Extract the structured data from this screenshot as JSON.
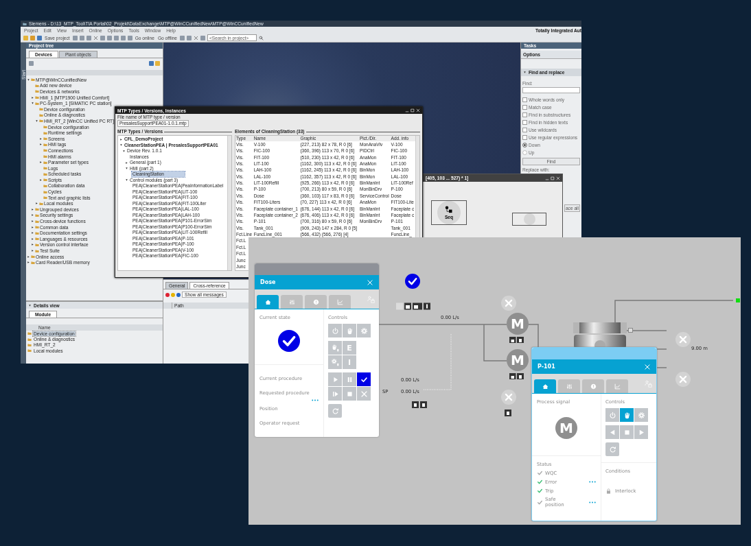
{
  "tia": {
    "title": "Siemens  -  D:\\13_MTP_Tool\\TIA Portal\\02_Projekt\\DataExchange\\MTP@WinCCunifiedNew\\MTP@WinCCunifiedNew",
    "brand": "Totally Integrated Aut",
    "menu": [
      "Project",
      "Edit",
      "View",
      "Insert",
      "Online",
      "Options",
      "Tools",
      "Window",
      "Help"
    ],
    "toolbar": {
      "save": "Save project",
      "go_online": "Go online",
      "go_offline": "Go offline",
      "search_placeholder": "<Search in project>"
    },
    "start_tab": "Start",
    "project_tree": {
      "title": "Project tree",
      "tabs": [
        {
          "label": "Devices",
          "selected": true
        },
        {
          "label": "Plant objects",
          "selected": false
        }
      ],
      "items": [
        {
          "label": "MTP@WinCCunifiedNew",
          "expanded": true,
          "children": [
            {
              "label": "Add new device"
            },
            {
              "label": "Devices & networks"
            },
            {
              "label": "HMI_1 [MTP1900 Unified Comfort]",
              "expanded": false
            },
            {
              "label": "PC-System_1 [SIMATIC PC station]",
              "expanded": true,
              "children": [
                {
                  "label": "Device configuration"
                },
                {
                  "label": "Online & diagnostics"
                },
                {
                  "label": "HMI_RT_2 [WinCC Unified PC RT]",
                  "expanded": true,
                  "children": [
                    {
                      "label": "Device configuration"
                    },
                    {
                      "label": "Runtime settings"
                    },
                    {
                      "label": "Screens",
                      "expanded": false
                    },
                    {
                      "label": "HMI tags",
                      "expanded": false
                    },
                    {
                      "label": "Connections"
                    },
                    {
                      "label": "HMI alarms"
                    },
                    {
                      "label": "Parameter set types",
                      "expanded": false
                    },
                    {
                      "label": "Logs"
                    },
                    {
                      "label": "Scheduled tasks"
                    },
                    {
                      "label": "Scripts",
                      "expanded": false
                    },
                    {
                      "label": "Collaboration data"
                    },
                    {
                      "label": "Cycles"
                    },
                    {
                      "label": "Text and graphic lists"
                    }
                  ]
                },
                {
                  "label": "Local modules",
                  "expanded": false
                }
              ]
            },
            {
              "label": "Ungrouped devices",
              "expanded": false
            },
            {
              "label": "Security settings",
              "expanded": false
            },
            {
              "label": "Cross-device functions",
              "expanded": false
            },
            {
              "label": "Common data",
              "expanded": false
            },
            {
              "label": "Documentation settings",
              "expanded": false
            },
            {
              "label": "Languages & resources",
              "expanded": false
            },
            {
              "label": "Version control interface",
              "expanded": false
            },
            {
              "label": "Test Suite",
              "expanded": false
            }
          ]
        },
        {
          "label": "Online access",
          "expanded": false
        },
        {
          "label": "Card Reader/USB memory",
          "expanded": false
        }
      ]
    },
    "details_view": {
      "title": "Details view",
      "tab": "Module",
      "column": "Name",
      "rows": [
        {
          "label": "Device configuration",
          "selected": true
        },
        {
          "label": "Online & diagnostics",
          "selected": false
        },
        {
          "label": "HMI_RT_2",
          "selected": false
        },
        {
          "label": "Local modules",
          "selected": false
        }
      ]
    },
    "inspector": {
      "tabs": [
        {
          "label": "General",
          "selected": false
        },
        {
          "label": "Cross-reference",
          "selected": true
        }
      ],
      "filter": "Show all messages",
      "column": "Path"
    },
    "tasks": {
      "title": "Tasks",
      "section": "Options",
      "panel": "Find and replace",
      "find_label": "Find:",
      "options": [
        {
          "label": "Whole words only",
          "checked": false
        },
        {
          "label": "Match case",
          "checked": false
        },
        {
          "label": "Find in substructures",
          "checked": false
        },
        {
          "label": "Find in hidden texts",
          "checked": false
        },
        {
          "label": "Use wildcards",
          "checked": false
        },
        {
          "label": "Use regular expressions",
          "checked": false
        }
      ],
      "directions": [
        {
          "label": "Down",
          "selected": true
        },
        {
          "label": "Up",
          "selected": false
        }
      ],
      "find_button": "Find",
      "replace_label": "Replace with:",
      "replace_all": "ace all"
    }
  },
  "seq_window": {
    "title": "[405, 103 ... 527) * 1]",
    "block_label": "Seq"
  },
  "mtp_dialog": {
    "title": "MTP Types / Versions, Instances",
    "file_label": "File name of MTP type / version",
    "file_value": "PresalesSupportPEA01-1.0.1.mtp",
    "types_heading": "MTP Types / Versions",
    "types": [
      {
        "label": "CFL_DemoProject",
        "expanded": false,
        "selected": false
      },
      {
        "label": "CleanerStationPEA | PresalesSupportPEA01",
        "expanded": true,
        "selected": false,
        "children": [
          {
            "label": "Device Rev. 1.0.1",
            "expanded": true,
            "selected": false,
            "children": [
              {
                "label": "Instances",
                "selected": false
              },
              {
                "label": "General (part 1)",
                "expanded": false,
                "selected": false
              },
              {
                "label": "HMI (part 2)",
                "expanded": true,
                "selected": false,
                "children": [
                  {
                    "label": "CleaningStation",
                    "selected": true
                  }
                ]
              },
              {
                "label": "Control modules (part 3)",
                "expanded": true,
                "selected": false,
                "children": [
                  {
                    "label": "PEA|CleanerStationPEA|PeaInformationLabel",
                    "selected": false
                  },
                  {
                    "label": "PEA|CleanerStationPEA|LIT-100",
                    "selected": false
                  },
                  {
                    "label": "PEA|CleanerStationPEA|FIT-100",
                    "selected": false
                  },
                  {
                    "label": "PEA|CleanerStationPEA|FIT-100Liter",
                    "selected": false
                  },
                  {
                    "label": "PEA|CleanerStationPEA|LAL-100",
                    "selected": false
                  },
                  {
                    "label": "PEA|CleanerStationPEA|LAH-100",
                    "selected": false
                  },
                  {
                    "label": "PEA|CleanerStationPEA|P101-ErrorSim",
                    "selected": false
                  },
                  {
                    "label": "PEA|CleanerStationPEA|P100-ErrorSim",
                    "selected": false
                  },
                  {
                    "label": "PEA|CleanerStationPEA|LIT-100Refill",
                    "selected": false
                  },
                  {
                    "label": "PEA|CleanerStationPEA|P-101",
                    "selected": false
                  },
                  {
                    "label": "PEA|CleanerStationPEA|P-100",
                    "selected": false
                  },
                  {
                    "label": "PEA|CleanerStationPEA|V-100",
                    "selected": false
                  },
                  {
                    "label": "PEA|CleanerStationPEA|FIC-100",
                    "selected": false
                  }
                ]
              }
            ]
          }
        ]
      }
    ],
    "elements_heading": "Elements of CleaningStation (33)",
    "columns": [
      "Type",
      "Name",
      "Graphic",
      "Pict./Dir.",
      "Add. info"
    ],
    "rows": [
      {
        "type": "Vis.",
        "name": "V-100",
        "graphic": "(227, 213) 82 x 78, R 0 [6]",
        "pict": "MonAnaVlv",
        "info": "V-100"
      },
      {
        "type": "Vis.",
        "name": "FIC-100",
        "graphic": "(360, 396) 113 x 70, R 0 [6]",
        "pict": "PIDCtrl",
        "info": "FIC-100"
      },
      {
        "type": "Vis.",
        "name": "FIT-100",
        "graphic": "(510, 230) 113 x 42, R 0 [6]",
        "pict": "AnaMon",
        "info": "FIT-100"
      },
      {
        "type": "Vis.",
        "name": "LIT-100",
        "graphic": "(1162, 300) 113 x 42, R 0 [6]",
        "pict": "AnaMon",
        "info": "LIT-100"
      },
      {
        "type": "Vis.",
        "name": "LAH-100",
        "graphic": "(1162, 245) 113 x 42, R 0 [6]",
        "pict": "BinMon",
        "info": "LAH-100"
      },
      {
        "type": "Vis.",
        "name": "LAL-100",
        "graphic": "(1162, 357) 113 x 42, R 0 [6]",
        "pict": "BinMon",
        "info": "LAL-100"
      },
      {
        "type": "Vis.",
        "name": "LIT-100Refill",
        "graphic": "(925, 266) 113 x 42, R 0 [6]",
        "pict": "BinManInt",
        "info": "LIT-100Ref"
      },
      {
        "type": "Vis.",
        "name": "P-100",
        "graphic": "(700, 213) 80 x 59, R 0 [6]",
        "pict": "MonBinDrv",
        "info": "P-100"
      },
      {
        "type": "Vis.",
        "name": "Dose",
        "graphic": "(360, 103) 117 x 83, R 0 [6]",
        "pict": "ServiceControl",
        "info": "Dose"
      },
      {
        "type": "Vis.",
        "name": "FIT100-Liters",
        "graphic": "(70, 227) 113 x 42, R 0 [6]",
        "pict": "AnaMon",
        "info": "FIT100-Lite"
      },
      {
        "type": "Vis.",
        "name": "Faceplate container_1",
        "graphic": "(676, 144) 113 x 42, R 0 [6]",
        "pict": "BinManInt",
        "info": "Faceplate c"
      },
      {
        "type": "Vis.",
        "name": "Faceplate container_2",
        "graphic": "(676, 406) 113 x 42, R 0 [6]",
        "pict": "BinManInt",
        "info": "Faceplate c"
      },
      {
        "type": "Vis.",
        "name": "P-101",
        "graphic": "(700, 316) 80 x 59, R 0 [6]",
        "pict": "MonBinDrv",
        "info": "P-101"
      },
      {
        "type": "Vis.",
        "name": "Tank_001",
        "graphic": "(909, 243) 147 x 284, R 0 [5]",
        "info": "Tank_001"
      },
      {
        "type": "Fct.Line",
        "name": "FuncLine_001",
        "graphic": "(566, 432) (566, 276) [4]",
        "info": "FuncLine_"
      },
      {
        "type": "Fct.L"
      },
      {
        "type": "Fct.L"
      },
      {
        "type": "Fct.L"
      },
      {
        "type": "Junc"
      },
      {
        "type": "Junc"
      }
    ]
  },
  "hmi": {
    "flow_top": "0.00 L/s",
    "flow_pv": "0.00 L/s",
    "sp_label": "SP",
    "flow_sp": "0.00 L/s",
    "tank_reading": "9.00 m",
    "motors": [
      {
        "label": "M"
      },
      {
        "label": "M"
      }
    ],
    "dose": {
      "title": "Dose",
      "tabs": [
        {
          "kind": "home",
          "selected": true
        },
        {
          "kind": "sliders",
          "selected": false
        },
        {
          "kind": "alert",
          "selected": false
        },
        {
          "kind": "trend",
          "selected": false
        }
      ],
      "state_label": "Current state",
      "procedure_label": "Current procedure",
      "requested_label": "Requested procedure",
      "position_label": "Position",
      "operator_label": "Operator request",
      "controls_label": "Controls",
      "mode_buttons": [
        {
          "kind": "power",
          "selected": false
        },
        {
          "kind": "hand",
          "selected": false
        },
        {
          "kind": "gear",
          "selected": false
        }
      ],
      "source_buttons": [
        {
          "kind": "hand-auto",
          "selected": false
        },
        {
          "kind": "text",
          "label": "E",
          "selected": false
        },
        {
          "kind": "gear-auto",
          "selected": false
        },
        {
          "kind": "text",
          "label": "I",
          "selected": false
        }
      ],
      "command_buttons": [
        {
          "kind": "play",
          "selected": false
        },
        {
          "kind": "pause",
          "selected": false
        },
        {
          "kind": "check",
          "selected": true
        },
        {
          "kind": "step",
          "selected": false
        },
        {
          "kind": "stop",
          "selected": false
        },
        {
          "kind": "cancel",
          "selected": false
        }
      ]
    },
    "pump": {
      "title": "P-101",
      "tabs": [
        {
          "kind": "home",
          "selected": true
        },
        {
          "kind": "sliders",
          "selected": false
        },
        {
          "kind": "alert",
          "selected": false
        },
        {
          "kind": "trend",
          "selected": false
        }
      ],
      "signal_label": "Process signal",
      "signal": "M",
      "controls_label": "Controls",
      "mode_buttons": [
        {
          "kind": "power",
          "selected": false
        },
        {
          "kind": "hand",
          "selected": true
        },
        {
          "kind": "gear",
          "selected": false
        }
      ],
      "direction_buttons": [
        {
          "kind": "left",
          "selected": false
        },
        {
          "kind": "stop",
          "selected": false
        },
        {
          "kind": "right",
          "selected": false
        }
      ],
      "status_label": "Status",
      "status": [
        {
          "label": "WQC",
          "ok": false,
          "more": false
        },
        {
          "label": "Error",
          "ok": true,
          "more": true
        },
        {
          "label": "Trip",
          "ok": true,
          "more": false
        },
        {
          "label": "Safe position",
          "ok": false,
          "more": true
        }
      ],
      "conditions_label": "Conditions",
      "interlock": "Interlock"
    }
  }
}
